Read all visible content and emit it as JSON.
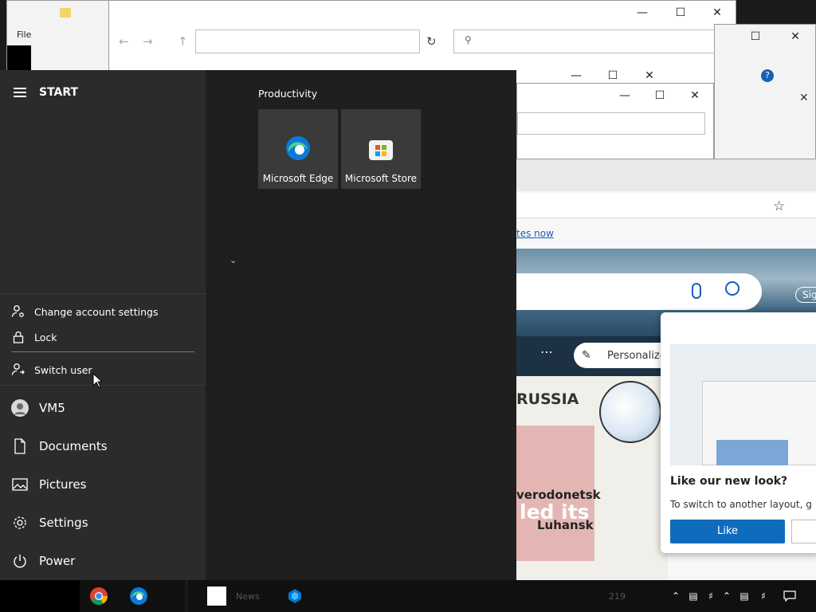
{
  "start_menu": {
    "header_label": "START",
    "group_title": "Productivity",
    "tiles": [
      {
        "label": "Microsoft Edge",
        "icon": "edge-icon"
      },
      {
        "label": "Microsoft Store",
        "icon": "store-icon"
      }
    ],
    "account_flyout": {
      "items": [
        {
          "label": "Change account settings",
          "icon": "account-settings-icon"
        },
        {
          "label": "Lock",
          "icon": "lock-icon"
        },
        {
          "label": "Switch user",
          "icon": "switch-user-icon"
        }
      ]
    },
    "rail": {
      "user": "VM5",
      "documents": "Documents",
      "pictures": "Pictures",
      "settings": "Settings",
      "power": "Power"
    }
  },
  "background": {
    "explorer_menu": "File",
    "browser": {
      "link_text": "tes now",
      "personalize": "Personalize",
      "sign_in": "Sign",
      "map_labels": [
        "RUSSIA",
        "verodonetsk",
        "led its",
        "Luhansk"
      ]
    },
    "popup": {
      "title": "Like our new look?",
      "text": "To switch to another layout, g",
      "like_button": "Like"
    }
  },
  "taskbar": {
    "apps": [
      "chrome-icon",
      "edge-icon",
      "file-explorer-icon",
      "azure-icon"
    ],
    "news_label": "News",
    "news_count": "219"
  },
  "colors": {
    "start_background": "#1f1f1f",
    "rail_background": "#2b2b2b",
    "tile_background": "#3a3a3a",
    "taskbar": "#101010",
    "like_button": "#0f6cbd"
  }
}
